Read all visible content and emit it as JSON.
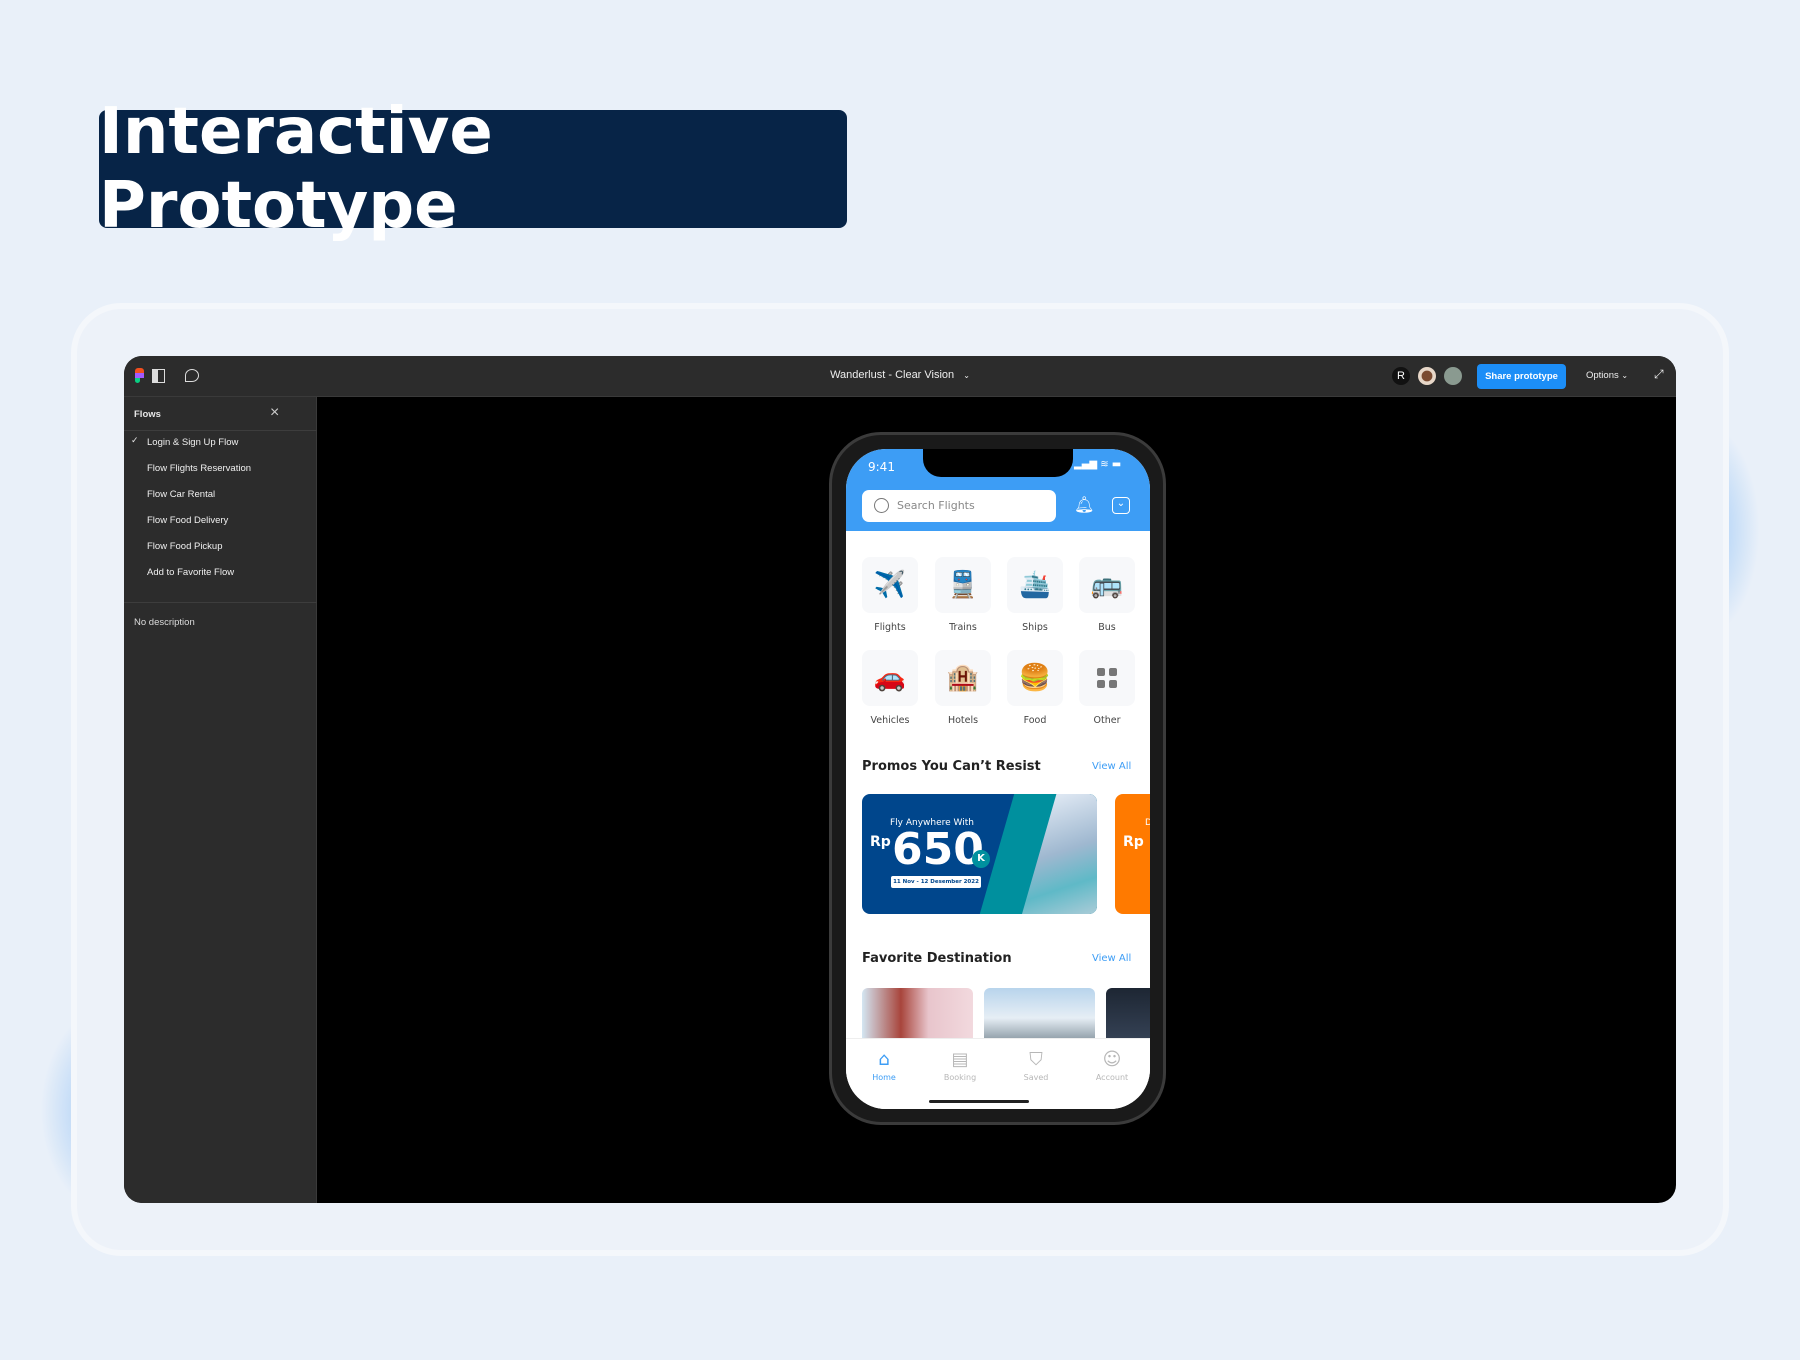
{
  "hero": {
    "title": "Interactive Prototype"
  },
  "toolbar": {
    "file_title": "Wanderlust - Clear Vision",
    "share_label": "Share prototype",
    "options_label": "Options",
    "icons": [
      "figma-logo",
      "sidebar-toggle-icon",
      "comment-icon",
      "chevron-down-icon",
      "expand-icon"
    ]
  },
  "sidebar": {
    "header": "Flows",
    "flows": [
      {
        "label": "Login & Sign Up Flow",
        "selected": true
      },
      {
        "label": "Flow Flights Reservation",
        "selected": false
      },
      {
        "label": "Flow Car Rental",
        "selected": false
      },
      {
        "label": "Flow Food Delivery",
        "selected": false
      },
      {
        "label": "Flow Food Pickup",
        "selected": false
      },
      {
        "label": "Add to Favorite Flow",
        "selected": false
      }
    ],
    "description": "No description"
  },
  "app": {
    "time": "9:41",
    "search_placeholder": "Search Flights",
    "categories": [
      {
        "label": "Flights",
        "icon": "✈️"
      },
      {
        "label": "Trains",
        "icon": "🚆"
      },
      {
        "label": "Ships",
        "icon": "🛳️"
      },
      {
        "label": "Bus",
        "icon": "🚌"
      },
      {
        "label": "Vehicles",
        "icon": "🚗"
      },
      {
        "label": "Hotels",
        "icon": "🏨"
      },
      {
        "label": "Food",
        "icon": "🍔"
      },
      {
        "label": "Other",
        "icon": "grid"
      }
    ],
    "promos": {
      "heading": "Promos You Can’t Resist",
      "view_all": "View All",
      "card": {
        "tagline": "Fly Anywhere With",
        "currency": "Rp",
        "amount": "650",
        "suffix": "K",
        "dates": "11 Nov - 12 Desember 2022"
      },
      "next_card": {
        "currency": "Rp",
        "tagline_start": "D"
      }
    },
    "destinations": {
      "heading": "Favorite Destination",
      "view_all": "View All"
    },
    "tabs": [
      {
        "label": "Home",
        "active": true
      },
      {
        "label": "Booking",
        "active": false
      },
      {
        "label": "Saved",
        "active": false
      },
      {
        "label": "Account",
        "active": false
      }
    ],
    "colors": {
      "primary": "#3d9df5",
      "promo_blue": "#00468c",
      "teal": "#00909e",
      "orange": "#ff7a00"
    }
  }
}
